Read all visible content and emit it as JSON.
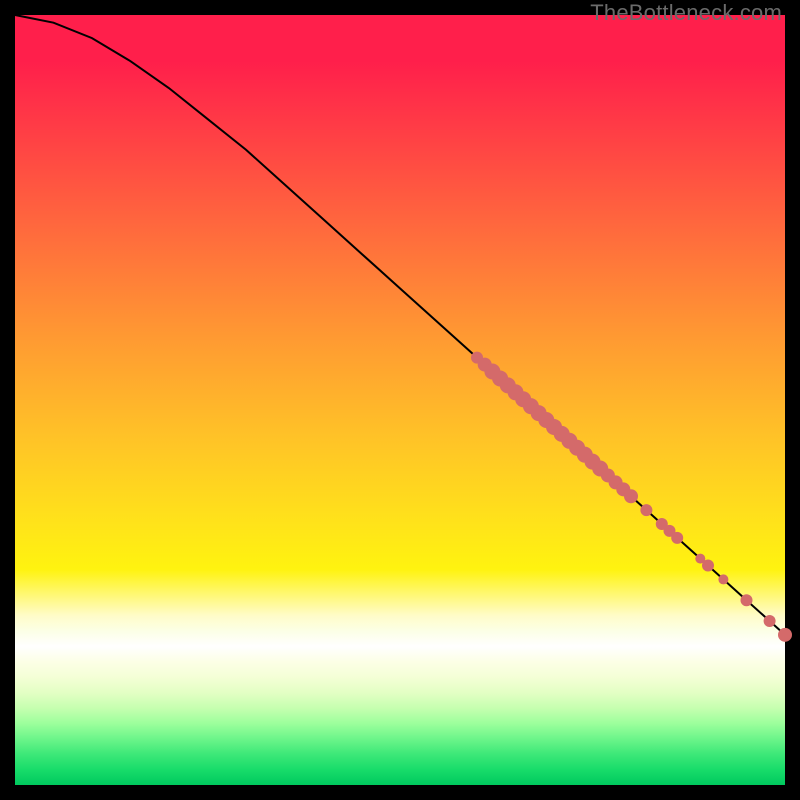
{
  "watermark": "TheBottleneck.com",
  "chart_data": {
    "type": "line",
    "title": "",
    "xlabel": "",
    "ylabel": "",
    "xlim": [
      0,
      100
    ],
    "ylim": [
      0,
      100
    ],
    "curve": {
      "name": "bottleneck-curve",
      "x": [
        0,
        5,
        10,
        15,
        20,
        25,
        30,
        35,
        40,
        45,
        50,
        55,
        60,
        65,
        70,
        75,
        80,
        85,
        90,
        95,
        100
      ],
      "y": [
        100,
        99,
        97,
        94,
        90.5,
        86.5,
        82.5,
        78,
        73.5,
        69,
        64.5,
        60,
        55.5,
        51,
        46.5,
        42,
        37.5,
        33,
        28.5,
        24,
        19.5
      ]
    },
    "points": {
      "name": "highlight-cluster",
      "color": "#d46a6a",
      "x": [
        60,
        61,
        62,
        63,
        64,
        65,
        66,
        67,
        68,
        69,
        70,
        71,
        72,
        73,
        74,
        75,
        76,
        77,
        78,
        79,
        80,
        82,
        84,
        85,
        86,
        89,
        90,
        92,
        95,
        98,
        100
      ],
      "y": [
        55.5,
        54.6,
        53.7,
        52.8,
        51.9,
        51.0,
        50.1,
        49.2,
        48.3,
        47.4,
        46.5,
        45.6,
        44.7,
        43.8,
        42.9,
        42.0,
        41.1,
        40.2,
        39.3,
        38.4,
        37.5,
        35.7,
        33.9,
        33.0,
        32.1,
        29.4,
        28.5,
        26.7,
        24.0,
        21.3,
        19.5
      ],
      "r": [
        6,
        7,
        8,
        8,
        8,
        8,
        8,
        8,
        8,
        8,
        8,
        8,
        8,
        8,
        8,
        8,
        8,
        7,
        7,
        7,
        7,
        6,
        6,
        6,
        6,
        5,
        6,
        5,
        6,
        6,
        7
      ]
    }
  },
  "colors": {
    "curve": "#000000",
    "points": "#d46a6a"
  }
}
